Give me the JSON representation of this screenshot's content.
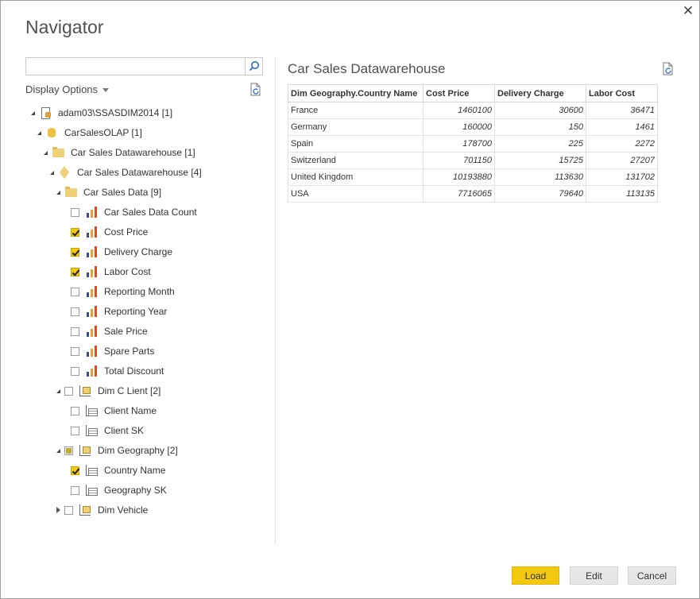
{
  "window": {
    "title": "Navigator",
    "close_glyph": "✕"
  },
  "search": {
    "value": "",
    "placeholder": ""
  },
  "display_options_label": "Display Options",
  "tree": {
    "server": "adam03\\SSASDIM2014 [1]",
    "database": "CarSalesOLAP [1]",
    "folder_dw": "Car Sales Datawarehouse [1]",
    "cube": "Car Sales Datawarehouse [4]",
    "measure_group": "Car Sales Data [9]",
    "measures": [
      {
        "label": "Car Sales Data Count",
        "checked": false
      },
      {
        "label": "Cost Price",
        "checked": true
      },
      {
        "label": "Delivery Charge",
        "checked": true
      },
      {
        "label": "Labor Cost",
        "checked": true
      },
      {
        "label": "Reporting Month",
        "checked": false
      },
      {
        "label": "Reporting Year",
        "checked": false
      },
      {
        "label": "Sale Price",
        "checked": false
      },
      {
        "label": "Spare Parts",
        "checked": false
      },
      {
        "label": "Total Discount",
        "checked": false
      }
    ],
    "dim_client": {
      "label": "Dim C Lient [2]",
      "state": "unchecked"
    },
    "client_attrs": [
      {
        "label": "Client Name",
        "checked": false
      },
      {
        "label": "Client SK",
        "checked": false
      }
    ],
    "dim_geography": {
      "label": "Dim Geography [2]",
      "state": "partial"
    },
    "geography_attrs": [
      {
        "label": "Country Name",
        "checked": true
      },
      {
        "label": "Geography SK",
        "checked": false
      }
    ],
    "dim_vehicle": {
      "label": "Dim Vehicle",
      "state": "unchecked"
    }
  },
  "preview": {
    "title": "Car Sales Datawarehouse",
    "columns": [
      "Dim Geography.Country Name",
      "Cost Price",
      "Delivery Charge",
      "Labor Cost"
    ],
    "rows": [
      [
        "France",
        "1460100",
        "30600",
        "36471"
      ],
      [
        "Germany",
        "160000",
        "150",
        "1461"
      ],
      [
        "Spain",
        "178700",
        "225",
        "2272"
      ],
      [
        "Switzerland",
        "701150",
        "15725",
        "27207"
      ],
      [
        "United Kingdom",
        "10193880",
        "113630",
        "131702"
      ],
      [
        "USA",
        "7716065",
        "79640",
        "113135"
      ]
    ]
  },
  "buttons": {
    "load": "Load",
    "edit": "Edit",
    "cancel": "Cancel"
  },
  "colors": {
    "accent": "#f2c811",
    "measure_bar_1": "#404a8a",
    "measure_bar_2": "#e8a030",
    "measure_bar_3": "#d84d25"
  }
}
